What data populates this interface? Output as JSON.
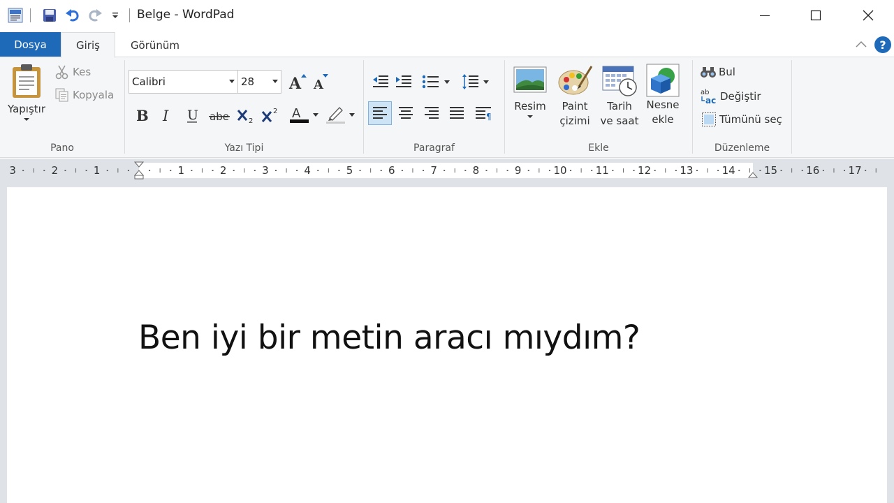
{
  "window": {
    "title": "Belge - WordPad"
  },
  "tabs": {
    "file": "Dosya",
    "home": "Giriş",
    "view": "Görünüm"
  },
  "help_label": "?",
  "groups": {
    "clipboard": {
      "label": "Pano",
      "paste": "Yapıştır",
      "cut": "Kes",
      "copy": "Kopyala"
    },
    "font": {
      "label": "Yazı Tipi",
      "font_name": "Calibri",
      "font_size": "28"
    },
    "paragraph": {
      "label": "Paragraf"
    },
    "insert": {
      "label": "Ekle",
      "picture": "Resim",
      "paint_line1": "Paint",
      "paint_line2": "çizimi",
      "datetime_line1": "Tarih",
      "datetime_line2": "ve saat",
      "object_line1": "Nesne",
      "object_line2": "ekle"
    },
    "editing": {
      "label": "Düzenleme",
      "find": "Bul",
      "replace": "Değiştir",
      "select_all": "Tümünü seç"
    }
  },
  "ruler": {
    "numbers": [
      "3",
      "2",
      "1",
      "1",
      "2",
      "3",
      "4",
      "5",
      "6",
      "7",
      "8",
      "9",
      "10",
      "11",
      "12",
      "13",
      "14",
      "15",
      "16",
      "17"
    ]
  },
  "document": {
    "text": "Ben iyi bir metin aracı mıydım?"
  },
  "colors": {
    "accent": "#1e6ab8",
    "ribbon_bg": "#f5f6f7",
    "font_color_bar": "#111111"
  }
}
